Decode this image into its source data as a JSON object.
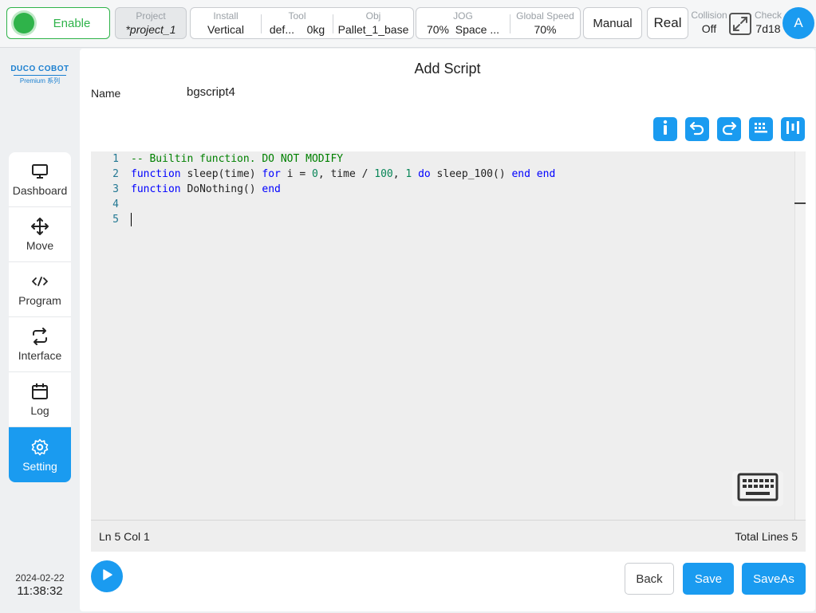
{
  "topbar": {
    "enable_label": "Enable",
    "project": {
      "label": "Project",
      "value": "*project_1"
    },
    "install": {
      "label": "Install",
      "value": "Vertical"
    },
    "tool": {
      "label": "Tool",
      "value_name": "def...",
      "value_load": "0kg"
    },
    "obj": {
      "label": "Obj",
      "value": "Pallet_1_base"
    },
    "jog": {
      "label": "JOG",
      "value_speed": "70%",
      "value_mode": "Space ..."
    },
    "global_speed": {
      "label": "Global Speed",
      "value": "70%"
    },
    "mode_label": "Manual",
    "real_label": "Real",
    "collision": {
      "label": "Collision",
      "value": "Off"
    },
    "check": {
      "label": "Check",
      "value": "7d18"
    },
    "avatar_letter": "A",
    "enable_color": "#2fb34a"
  },
  "sidebar": {
    "logo_main": "DUCO COBOT",
    "logo_sub": "Premium 系列",
    "items": [
      {
        "label": "Dashboard",
        "icon": "monitor-icon"
      },
      {
        "label": "Move",
        "icon": "move-arrows-icon"
      },
      {
        "label": "Program",
        "icon": "code-icon"
      },
      {
        "label": "Interface",
        "icon": "swap-arrows-icon"
      },
      {
        "label": "Log",
        "icon": "calendar-icon"
      },
      {
        "label": "Setting",
        "icon": "gear-icon",
        "active": true
      }
    ],
    "date": "2024-02-22",
    "time": "11:38:32"
  },
  "main": {
    "title": "Add Script",
    "name_label": "Name",
    "name_value": "bgscript4",
    "toolbar": [
      "info-icon",
      "undo-icon",
      "redo-icon",
      "keypad-icon",
      "format-bars-icon"
    ],
    "editor": {
      "line_numbers": [
        "1",
        "2",
        "3",
        "4",
        "5"
      ],
      "lines": [
        [
          {
            "t": "-- Builtin function. DO NOT MODIFY",
            "c": "comment"
          }
        ],
        [
          {
            "t": "function",
            "c": "kw"
          },
          {
            "t": " sleep(time) ",
            "c": ""
          },
          {
            "t": "for",
            "c": "kw"
          },
          {
            "t": " i = ",
            "c": ""
          },
          {
            "t": "0",
            "c": "num"
          },
          {
            "t": ", time / ",
            "c": ""
          },
          {
            "t": "100",
            "c": "num"
          },
          {
            "t": ", ",
            "c": ""
          },
          {
            "t": "1",
            "c": "num"
          },
          {
            "t": " ",
            "c": ""
          },
          {
            "t": "do",
            "c": "kw"
          },
          {
            "t": " sleep_100() ",
            "c": ""
          },
          {
            "t": "end",
            "c": "kw"
          },
          {
            "t": " ",
            "c": ""
          },
          {
            "t": "end",
            "c": "kw"
          }
        ],
        [
          {
            "t": "function",
            "c": "kw"
          },
          {
            "t": " DoNothing() ",
            "c": ""
          },
          {
            "t": "end",
            "c": "kw"
          }
        ],
        [],
        []
      ]
    },
    "status_position": "Ln 5 Col 1",
    "status_total": "Total Lines 5",
    "buttons": {
      "back": "Back",
      "save": "Save",
      "save_as": "SaveAs"
    },
    "accent_color": "#1a9bf0"
  }
}
